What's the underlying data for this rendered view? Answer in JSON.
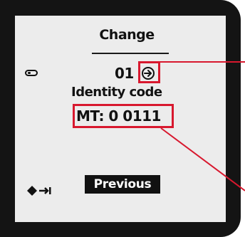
{
  "screen": {
    "title": "Change",
    "menu_number": "01",
    "label": "Identity code",
    "code_value": "MT: 0 0111",
    "previous_button": "Previous"
  },
  "icons": {
    "card": "card-icon",
    "arrow": "arrow-right-circle-icon",
    "navigation": "diamond-skip-arrow-icon"
  },
  "colors": {
    "bezel": "#141414",
    "display": "#ececec",
    "highlight": "#d8182e"
  }
}
